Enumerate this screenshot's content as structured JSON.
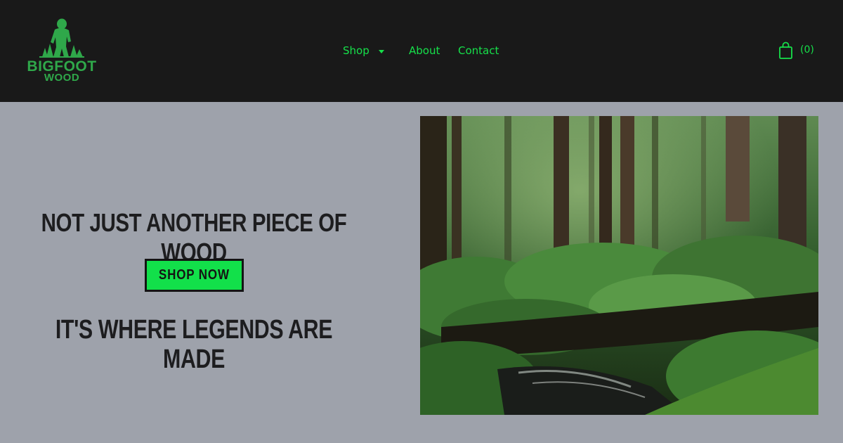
{
  "brand": {
    "logo_line1": "BIGFOOT",
    "logo_line2": "WOOD",
    "logo_color": "#2fa84a",
    "accent_color": "#16e04a"
  },
  "nav": {
    "shop": "Shop",
    "about": "About",
    "contact": "Contact"
  },
  "cart": {
    "count": "(0)",
    "icon": "shopping-bag-icon"
  },
  "hero": {
    "headline": "NOT JUST ANOTHER PIECE OF WOOD",
    "cta_label": "SHOP NOW",
    "tagline": "IT'S WHERE LEGENDS ARE MADE",
    "image": "forest-photo"
  }
}
